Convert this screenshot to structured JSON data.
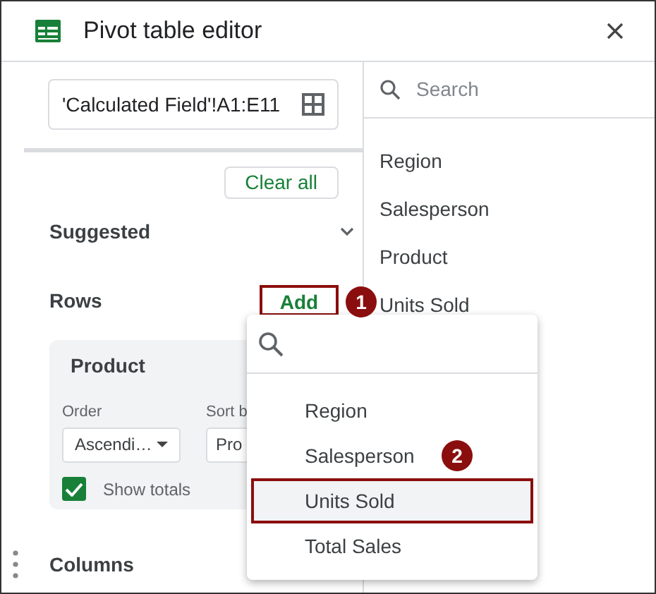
{
  "window": {
    "title": "Pivot table editor"
  },
  "range": {
    "value": "'Calculated Field'!A1:E11"
  },
  "clear_all": "Clear all",
  "suggested": {
    "label": "Suggested",
    "expanded": false
  },
  "rows": {
    "label": "Rows",
    "add": {
      "label": "Add",
      "highlighted": true
    },
    "row_field": {
      "name": "Product",
      "order_label": "Order",
      "order_value": "Ascendi…",
      "sort_label": "Sort b",
      "sort_value": "Pro",
      "show_totals": {
        "label": "Show totals",
        "checked": true
      }
    }
  },
  "columns": {
    "label": "Columns"
  },
  "fields_panel": {
    "placeholder": "Search",
    "items": [
      "Region",
      "Salesperson",
      "Product",
      "Units Sold"
    ]
  },
  "dropdown": {
    "items": [
      {
        "label": "Region",
        "selected": false
      },
      {
        "label": "Salesperson",
        "selected": false
      },
      {
        "label": "Units Sold",
        "selected": true
      },
      {
        "label": "Total Sales",
        "selected": false
      }
    ]
  },
  "callouts": [
    {
      "number": "1"
    },
    {
      "number": "2"
    }
  ]
}
